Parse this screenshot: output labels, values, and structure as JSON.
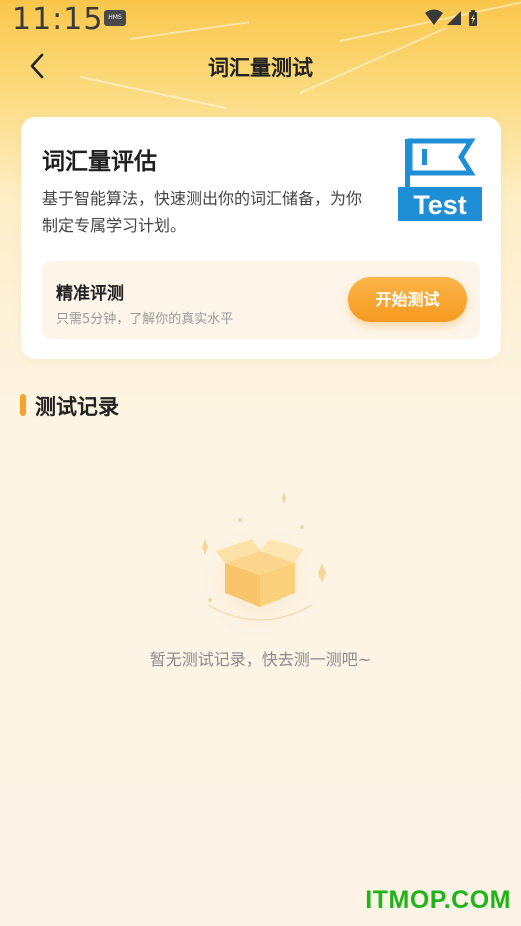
{
  "status_bar": {
    "time": "11:15",
    "hms_badge": "HMS"
  },
  "nav": {
    "title": "词汇量测试"
  },
  "card": {
    "title": "词汇量评估",
    "description": "基于智能算法，快速测出你的词汇储备，为你制定专属学习计划。",
    "logo_text": "Test",
    "panel": {
      "title": "精准评测",
      "subtitle": "只需5分钟，了解你的真实水平",
      "button_label": "开始测试"
    }
  },
  "records": {
    "section_title": "测试记录",
    "empty_text": "暂无测试记录，快去测一测吧~"
  },
  "watermark": "ITMOP.COM",
  "colors": {
    "accent": "#f7a12e",
    "logo_blue": "#1e8fd6",
    "watermark_green": "#1fb51a"
  }
}
